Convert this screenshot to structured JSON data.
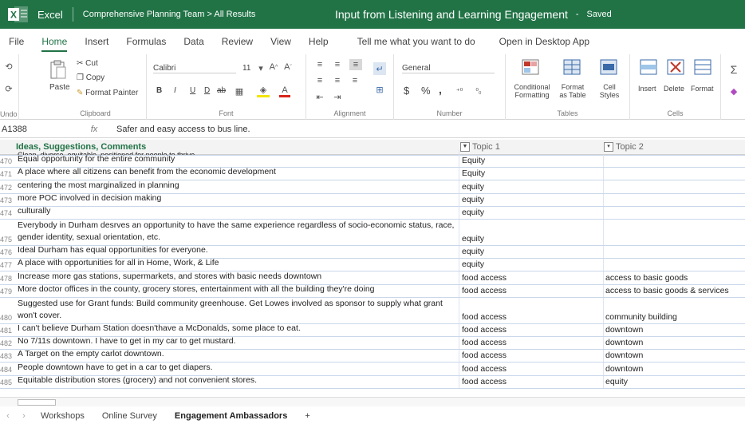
{
  "titlebar": {
    "app": "Excel",
    "breadcrumb": "Comprehensive Planning Team > All Results",
    "doc_title": "Input from Listening and Learning Engagement",
    "separator": "-",
    "status": "Saved",
    "bg_color": "#217346"
  },
  "menu": {
    "tabs": [
      "File",
      "Home",
      "Insert",
      "Formulas",
      "Data",
      "Review",
      "View",
      "Help",
      "Tell me what you want to do",
      "Open in Desktop App"
    ],
    "active": "Home"
  },
  "ribbon": {
    "undo": "Undo",
    "clipboard": {
      "paste": "Paste",
      "cut": "Cut",
      "copy": "Copy",
      "format_painter": "Format Painter",
      "name": "Clipboard"
    },
    "font": {
      "family": "Calibri",
      "size": "11",
      "bold": "B",
      "italic": "I",
      "underline": "U",
      "strike": "ab",
      "name": "Font"
    },
    "alignment": {
      "name": "Alignment"
    },
    "number": {
      "format": "General",
      "currency": "$",
      "percent": "%",
      "comma": ",",
      "name": "Number"
    },
    "tables": {
      "conditional": "Conditional\nFormatting",
      "format_table": "Format\nas Table",
      "cell_styles": "Cell\nStyles",
      "name": "Tables"
    },
    "cells": {
      "insert": "Insert",
      "delete": "Delete",
      "format": "Format",
      "name": "Cells"
    }
  },
  "formula_bar": {
    "name_box": "A1388",
    "fx": "fx",
    "value": "Safer and easy access to bus line."
  },
  "grid": {
    "headers": [
      "Ideas, Suggestions, Comments",
      "Topic 1",
      "Topic 2"
    ],
    "partial_row_text": "Clean, diverse, equitable, positioned for people to thrive",
    "rows": [
      {
        "n": "470",
        "a": "Equal opportunity for the entire community",
        "b": "Equity",
        "c": ""
      },
      {
        "n": "471",
        "a": "A place where all citizens can benefit from the economic development",
        "b": "Equity",
        "c": ""
      },
      {
        "n": "472",
        "a": "centering the most marginalized in planning",
        "b": "equity",
        "c": ""
      },
      {
        "n": "473",
        "a": "more POC involved in decision making",
        "b": "equity",
        "c": ""
      },
      {
        "n": "474",
        "a": "culturally",
        "b": "equity",
        "c": ""
      },
      {
        "n": "475",
        "a": "Everybody in Durham desrves an opportunity to have the same experience regardless of socio-economic status, race, gender identity, sexual orientation, etc.",
        "b": "equity",
        "c": "",
        "tall": true
      },
      {
        "n": "476",
        "a": "Ideal Durham has equal opportunities for everyone.",
        "b": "equity",
        "c": ""
      },
      {
        "n": "477",
        "a": "A place with opportunities for all in Home, Work, & Life",
        "b": "equity",
        "c": ""
      },
      {
        "n": "478",
        "a": "Increase more gas stations, supermarkets, and stores with basic needs downtown",
        "b": "food access",
        "c": "access to basic goods"
      },
      {
        "n": "479",
        "a": "More doctor offices in the county, grocery stores, entertainment with all the building they're doing",
        "b": "food access",
        "c": "access to basic goods & services"
      },
      {
        "n": "480",
        "a": "Suggested use for Grant funds: Build community greenhouse. Get Lowes involved as sponsor to supply what grant won't cover.",
        "b": "food access",
        "c": "community building",
        "tall": true
      },
      {
        "n": "481",
        "a": "I can't believe Durham Station doesn'thave a McDonalds, some place to eat.",
        "b": "food access",
        "c": "downtown"
      },
      {
        "n": "482",
        "a": "No 7/11s downtown. I have to get in my car to get mustard.",
        "b": "food access",
        "c": "downtown"
      },
      {
        "n": "483",
        "a": "A Target on the empty carlot downtown.",
        "b": "food access",
        "c": "downtown"
      },
      {
        "n": "484",
        "a": "People downtown have to get in a car to get diapers.",
        "b": "food access",
        "c": "downtown"
      },
      {
        "n": "485",
        "a": "Equitable distribution stores (grocery) and not convenient stores.",
        "b": "food access",
        "c": "equity"
      }
    ]
  },
  "sheets": {
    "tabs": [
      "Workshops",
      "Online Survey",
      "Engagement Ambassadors"
    ],
    "active": "Engagement Ambassadors",
    "add": "+"
  }
}
